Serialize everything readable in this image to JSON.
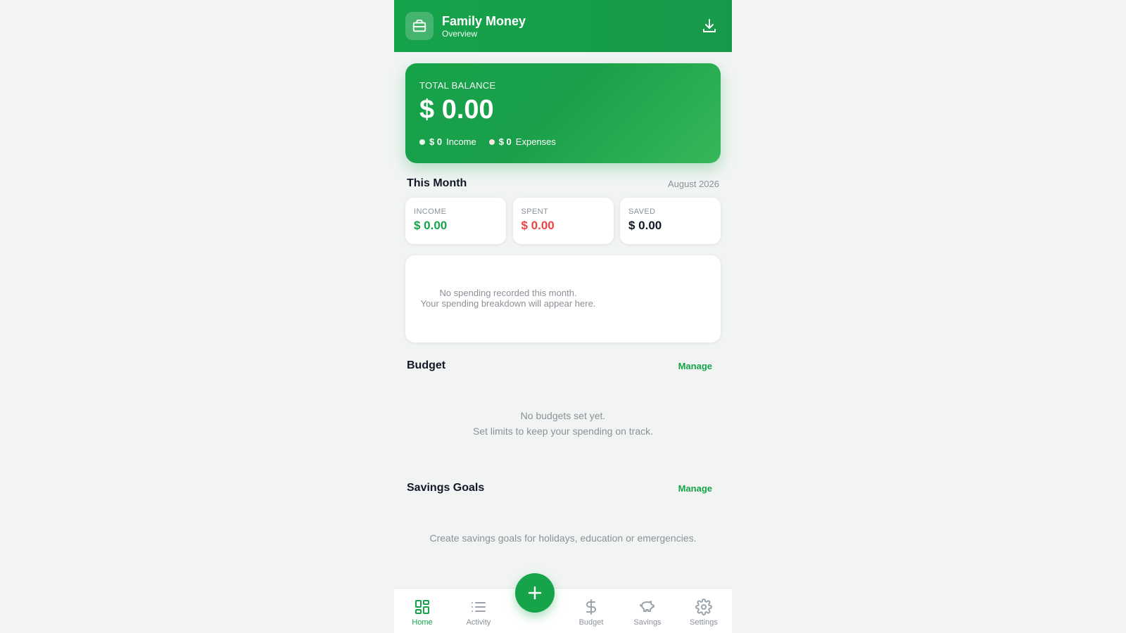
{
  "colors": {
    "accent": "#16a34a",
    "expense": "#ef4444",
    "muted": "#8b9199"
  },
  "header": {
    "title": "Family Money",
    "subtitle": "Overview",
    "logo_icon": "briefcase-icon",
    "action_icon": "download-icon"
  },
  "balance": {
    "label": "TOTAL BALANCE",
    "amount": "$ 0.00",
    "income_value": "$ 0",
    "income_label": "Income",
    "expense_value": "$ 0",
    "expense_label": "Expenses"
  },
  "this_month": {
    "title": "This Month",
    "date": "August 2026",
    "stats": [
      {
        "label": "INCOME",
        "value": "$ 0.00"
      },
      {
        "label": "SPENT",
        "value": "$ 0.00"
      },
      {
        "label": "SAVED",
        "value": "$ 0.00"
      }
    ],
    "empty_line1": "No spending recorded this month.",
    "empty_line2": "Your spending breakdown will appear here."
  },
  "budget": {
    "title": "Budget",
    "manage_label": "Manage",
    "empty_line1": "No budgets set yet.",
    "empty_line2": "Set limits to keep your spending on track."
  },
  "savings": {
    "title": "Savings Goals",
    "manage_label": "Manage",
    "empty_text": "Create savings goals for holidays, education or emergencies."
  },
  "nav": {
    "items": [
      {
        "label": "Home",
        "icon": "grid-icon",
        "active": true
      },
      {
        "label": "Activity",
        "icon": "list-icon",
        "active": false
      },
      {
        "label": "Budget",
        "icon": "dollar-icon",
        "active": false
      },
      {
        "label": "Savings",
        "icon": "piggy-bank-icon",
        "active": false
      },
      {
        "label": "Settings",
        "icon": "gear-icon",
        "active": false
      }
    ],
    "fab_icon": "plus-icon"
  }
}
